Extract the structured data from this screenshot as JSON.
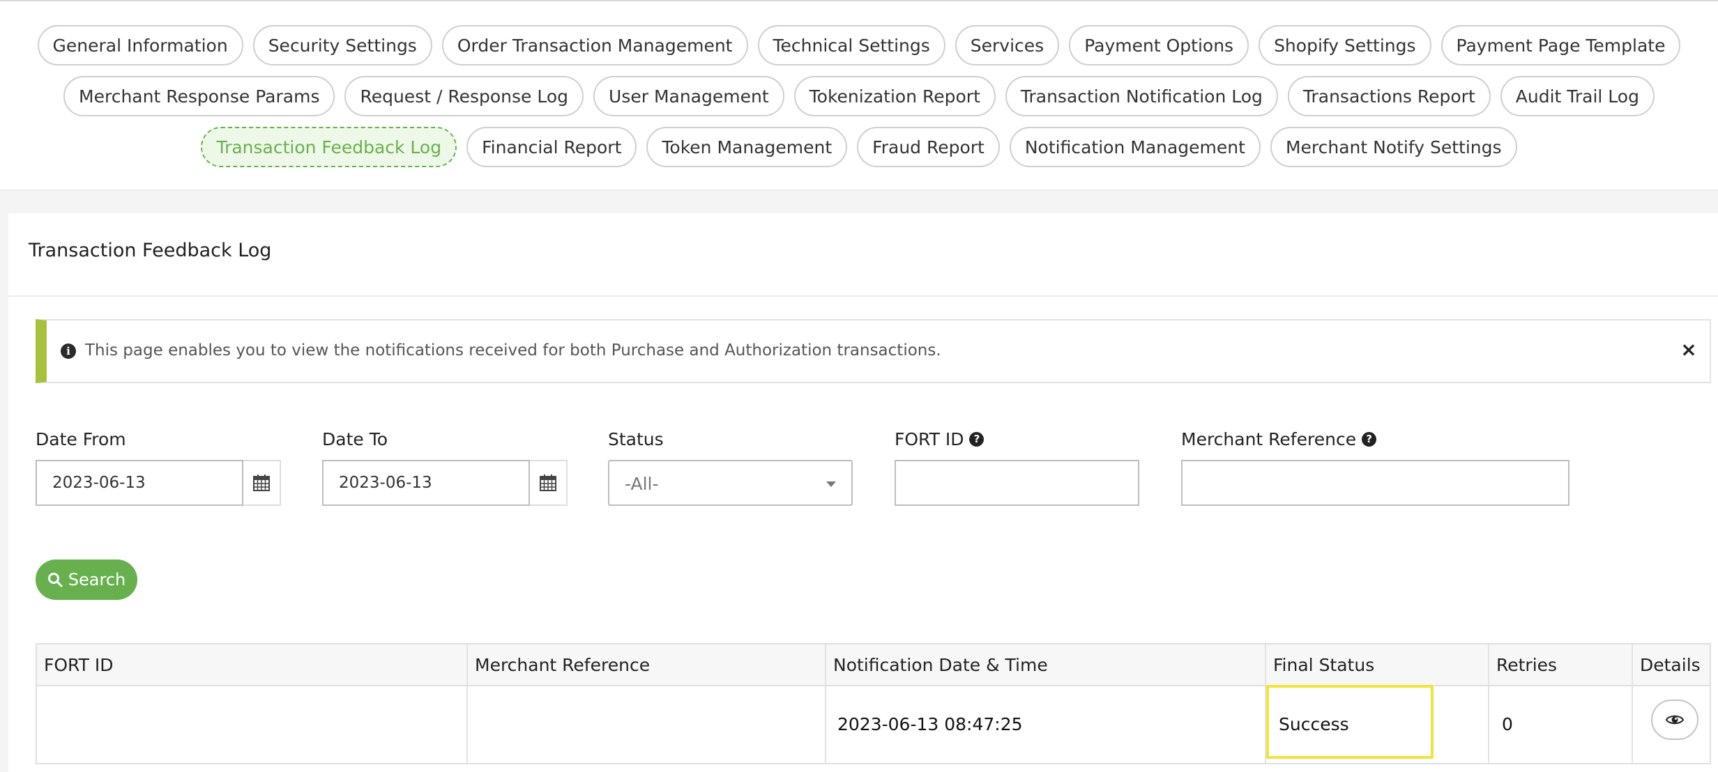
{
  "nav": {
    "rows": [
      [
        "General Information",
        "Security Settings",
        "Order Transaction Management",
        "Technical Settings",
        "Services",
        "Payment Options",
        "Shopify Settings",
        "Payment Page Template"
      ],
      [
        "Merchant Response Params",
        "Request / Response Log",
        "User Management",
        "Tokenization Report",
        "Transaction Notification Log",
        "Transactions Report",
        "Audit Trail Log"
      ],
      [
        "Transaction Feedback Log",
        "Financial Report",
        "Token Management",
        "Fraud Report",
        "Notification Management",
        "Merchant Notify Settings"
      ]
    ],
    "active": "Transaction Feedback Log",
    "active_color": "#6ab04c"
  },
  "page": {
    "title": "Transaction Feedback Log"
  },
  "alert": {
    "text": "This page enables you to view the notifications received for both Purchase and Authorization transactions.",
    "close_label": "×",
    "info_icon": "info-circle-icon",
    "accent_color": "#a5c23a"
  },
  "filters": {
    "date_from": {
      "label": "Date From",
      "value": "2023-06-13"
    },
    "date_to": {
      "label": "Date To",
      "value": "2023-06-13"
    },
    "status": {
      "label": "Status",
      "value": "-All-"
    },
    "fort_id": {
      "label": "FORT ID",
      "value": ""
    },
    "merchant_reference": {
      "label": "Merchant Reference",
      "value": ""
    },
    "search_label": "Search",
    "search_color": "#67b04d"
  },
  "table": {
    "columns": [
      "FORT ID",
      "Merchant Reference",
      "Notification Date & Time",
      "Final Status",
      "Retries",
      "Details"
    ],
    "rows": [
      {
        "fort_id": "",
        "merchant_reference": "",
        "notification_datetime": "2023-06-13 08:47:25",
        "final_status": "Success",
        "retries": "0",
        "details_icon": "eye-icon"
      }
    ],
    "highlight_color": "#f2e33a"
  }
}
